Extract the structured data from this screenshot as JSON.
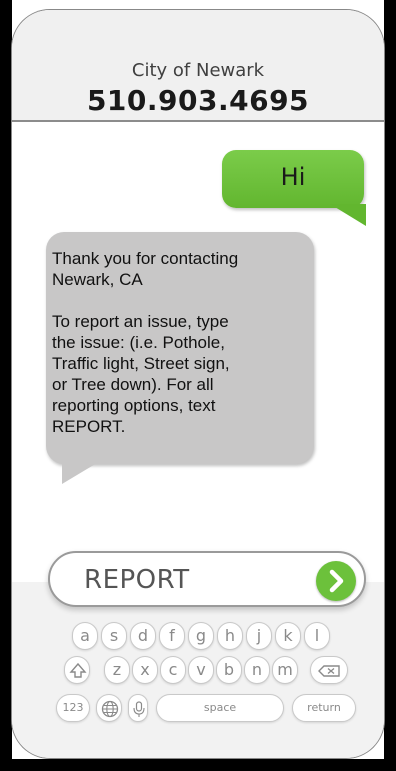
{
  "header": {
    "contact_name": "City of Newark",
    "contact_number": "510.903.4695"
  },
  "messages": [
    {
      "direction": "outgoing",
      "text": "Hi"
    },
    {
      "direction": "incoming",
      "text": "Thank you for contacting\nNewark, CA\n\nTo report an issue, type\nthe issue: (i.e. Pothole,\nTraffic light, Street sign,\nor Tree down).  For all\nreporting options, text\nREPORT."
    }
  ],
  "composer": {
    "value": "REPORT",
    "send_icon": "chevron-right-icon"
  },
  "keyboard": {
    "row1": [
      "a",
      "s",
      "d",
      "f",
      "g",
      "h",
      "j",
      "k",
      "l"
    ],
    "row2": [
      "z",
      "x",
      "c",
      "v",
      "b",
      "n",
      "m"
    ],
    "shift_icon": "shift-icon",
    "backspace_icon": "backspace-icon",
    "numbers_label": "123",
    "globe_icon": "globe-icon",
    "mic_icon": "microphone-icon",
    "space_label": "space",
    "return_label": "return"
  },
  "colors": {
    "accent_green": "#6cc13b",
    "incoming_bubble": "#c8c7c7"
  }
}
